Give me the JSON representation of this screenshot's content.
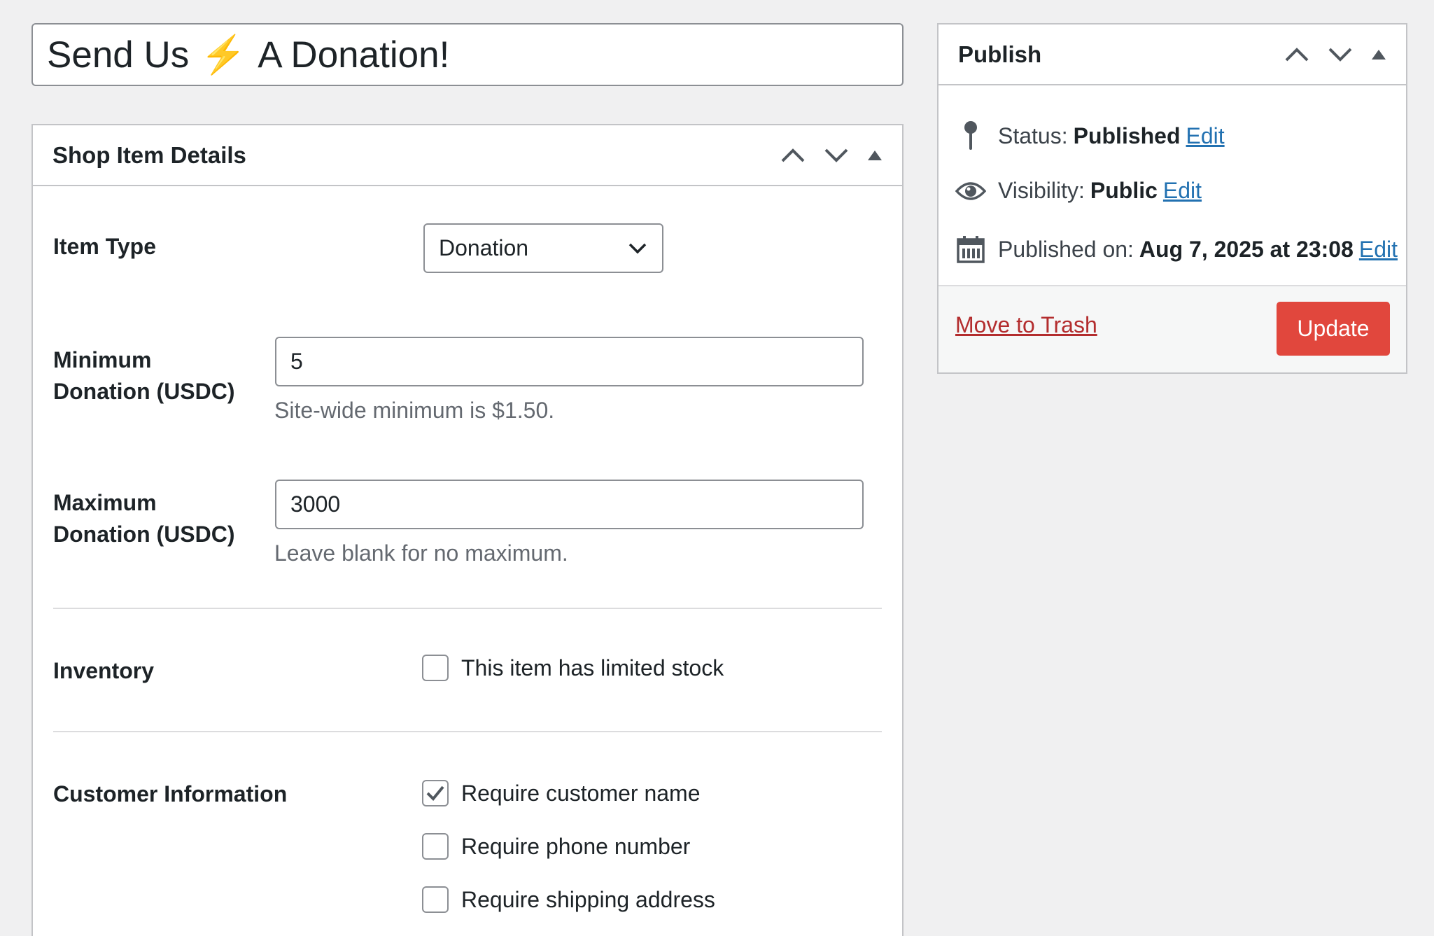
{
  "post_title": {
    "text_before": "Send Us",
    "emoji": "⚡",
    "text_after": "A Donation!"
  },
  "shop_box": {
    "title": "Shop Item Details",
    "item_type": {
      "label": "Item Type",
      "selected": "Donation"
    },
    "min_donation": {
      "label_line1": "Minimum",
      "label_line2": "Donation (USDC)",
      "value": "5",
      "description": "Site-wide minimum is $1.50."
    },
    "max_donation": {
      "label_line1": "Maximum",
      "label_line2": "Donation (USDC)",
      "value": "3000",
      "description": "Leave blank for no maximum."
    },
    "inventory": {
      "label": "Inventory",
      "checkbox_label": "This item has limited stock",
      "checked": false
    },
    "customer_info": {
      "label": "Customer Information",
      "options": [
        {
          "label": "Require customer name",
          "checked": true
        },
        {
          "label": "Require phone number",
          "checked": false
        },
        {
          "label": "Require shipping address",
          "checked": false
        }
      ]
    }
  },
  "publish_box": {
    "title": "Publish",
    "status": {
      "label": "Status:",
      "value": "Published",
      "edit": "Edit"
    },
    "visibility": {
      "label": "Visibility:",
      "value": "Public",
      "edit": "Edit"
    },
    "published_on": {
      "label": "Published on:",
      "value": "Aug 7, 2025 at 23:08",
      "edit": "Edit"
    },
    "trash_label": "Move to Trash",
    "update_label": "Update"
  },
  "colors": {
    "update_button": "#e1473d",
    "link": "#2271b1",
    "trash": "#b32d2e"
  }
}
